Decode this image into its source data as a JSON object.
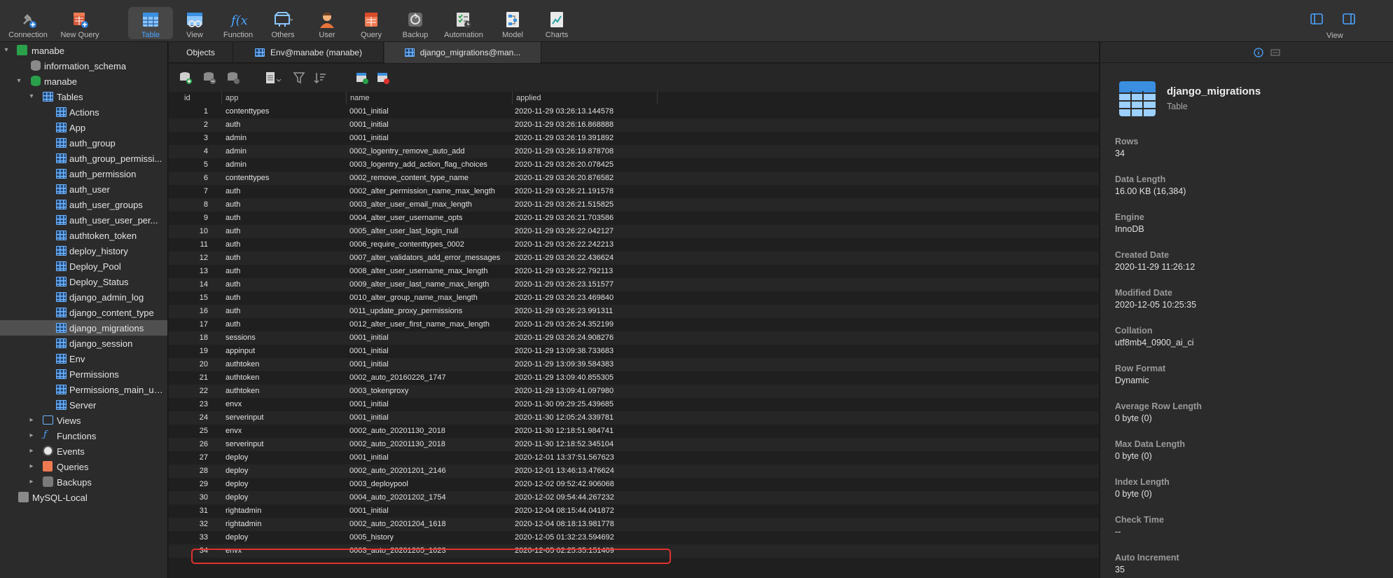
{
  "toolbar": {
    "connection": "Connection",
    "new_query": "New Query",
    "table": "Table",
    "view": "View",
    "function": "Function",
    "others": "Others",
    "user": "User",
    "query": "Query",
    "backup": "Backup",
    "automation": "Automation",
    "model": "Model",
    "charts": "Charts",
    "view_right": "View"
  },
  "sidebar": {
    "connection": "manabe",
    "db_information_schema": "information_schema",
    "db_manabe": "manabe",
    "tables_label": "Tables",
    "tables": [
      "Actions",
      "App",
      "auth_group",
      "auth_group_permissi...",
      "auth_permission",
      "auth_user",
      "auth_user_groups",
      "auth_user_user_per...",
      "authtoken_token",
      "deploy_history",
      "Deploy_Pool",
      "Deploy_Status",
      "django_admin_log",
      "django_content_type",
      "django_migrations",
      "django_session",
      "Env",
      "Permissions",
      "Permissions_main_us...",
      "Server"
    ],
    "views": "Views",
    "functions": "Functions",
    "events": "Events",
    "queries": "Queries",
    "backups": "Backups",
    "other_connection": "MySQL-Local"
  },
  "tabs": {
    "objects": "Objects",
    "env": "Env@manabe (manabe)",
    "migrations": "django_migrations@man..."
  },
  "grid": {
    "columns": {
      "id": "id",
      "app": "app",
      "name": "name",
      "applied": "applied"
    },
    "rows": [
      [
        "1",
        "contenttypes",
        "0001_initial",
        "2020-11-29 03:26:13.144578"
      ],
      [
        "2",
        "auth",
        "0001_initial",
        "2020-11-29 03:26:16.868888"
      ],
      [
        "3",
        "admin",
        "0001_initial",
        "2020-11-29 03:26:19.391892"
      ],
      [
        "4",
        "admin",
        "0002_logentry_remove_auto_add",
        "2020-11-29 03:26:19.878708"
      ],
      [
        "5",
        "admin",
        "0003_logentry_add_action_flag_choices",
        "2020-11-29 03:26:20.078425"
      ],
      [
        "6",
        "contenttypes",
        "0002_remove_content_type_name",
        "2020-11-29 03:26:20.876582"
      ],
      [
        "7",
        "auth",
        "0002_alter_permission_name_max_length",
        "2020-11-29 03:26:21.191578"
      ],
      [
        "8",
        "auth",
        "0003_alter_user_email_max_length",
        "2020-11-29 03:26:21.515825"
      ],
      [
        "9",
        "auth",
        "0004_alter_user_username_opts",
        "2020-11-29 03:26:21.703586"
      ],
      [
        "10",
        "auth",
        "0005_alter_user_last_login_null",
        "2020-11-29 03:26:22.042127"
      ],
      [
        "11",
        "auth",
        "0006_require_contenttypes_0002",
        "2020-11-29 03:26:22.242213"
      ],
      [
        "12",
        "auth",
        "0007_alter_validators_add_error_messages",
        "2020-11-29 03:26:22.436624"
      ],
      [
        "13",
        "auth",
        "0008_alter_user_username_max_length",
        "2020-11-29 03:26:22.792113"
      ],
      [
        "14",
        "auth",
        "0009_alter_user_last_name_max_length",
        "2020-11-29 03:26:23.151577"
      ],
      [
        "15",
        "auth",
        "0010_alter_group_name_max_length",
        "2020-11-29 03:26:23.469840"
      ],
      [
        "16",
        "auth",
        "0011_update_proxy_permissions",
        "2020-11-29 03:26:23.991311"
      ],
      [
        "17",
        "auth",
        "0012_alter_user_first_name_max_length",
        "2020-11-29 03:26:24.352199"
      ],
      [
        "18",
        "sessions",
        "0001_initial",
        "2020-11-29 03:26:24.908276"
      ],
      [
        "19",
        "appinput",
        "0001_initial",
        "2020-11-29 13:09:38.733683"
      ],
      [
        "20",
        "authtoken",
        "0001_initial",
        "2020-11-29 13:09:39.584383"
      ],
      [
        "21",
        "authtoken",
        "0002_auto_20160226_1747",
        "2020-11-29 13:09:40.855305"
      ],
      [
        "22",
        "authtoken",
        "0003_tokenproxy",
        "2020-11-29 13:09:41.097980"
      ],
      [
        "23",
        "envx",
        "0001_initial",
        "2020-11-30 09:29:25.439685"
      ],
      [
        "24",
        "serverinput",
        "0001_initial",
        "2020-11-30 12:05:24.339781"
      ],
      [
        "25",
        "envx",
        "0002_auto_20201130_2018",
        "2020-11-30 12:18:51.984741"
      ],
      [
        "26",
        "serverinput",
        "0002_auto_20201130_2018",
        "2020-11-30 12:18:52.345104"
      ],
      [
        "27",
        "deploy",
        "0001_initial",
        "2020-12-01 13:37:51.567623"
      ],
      [
        "28",
        "deploy",
        "0002_auto_20201201_2146",
        "2020-12-01 13:46:13.476624"
      ],
      [
        "29",
        "deploy",
        "0003_deploypool",
        "2020-12-02 09:52:42.906068"
      ],
      [
        "30",
        "deploy",
        "0004_auto_20201202_1754",
        "2020-12-02 09:54:44.267232"
      ],
      [
        "31",
        "rightadmin",
        "0001_initial",
        "2020-12-04 08:15:44.041872"
      ],
      [
        "32",
        "rightadmin",
        "0002_auto_20201204_1618",
        "2020-12-04 08:18:13.981778"
      ],
      [
        "33",
        "deploy",
        "0005_history",
        "2020-12-05 01:32:23.594692"
      ],
      [
        "34",
        "envx",
        "0003_auto_20201205_1023",
        "2020-12-05 02:25:35.151409"
      ]
    ]
  },
  "info": {
    "title": "django_migrations",
    "subtitle": "Table",
    "props": [
      {
        "label": "Rows",
        "value": "34"
      },
      {
        "label": "Data Length",
        "value": "16.00 KB (16,384)"
      },
      {
        "label": "Engine",
        "value": "InnoDB"
      },
      {
        "label": "Created Date",
        "value": "2020-11-29 11:26:12"
      },
      {
        "label": "Modified Date",
        "value": "2020-12-05 10:25:35"
      },
      {
        "label": "Collation",
        "value": "utf8mb4_0900_ai_ci"
      },
      {
        "label": "Row Format",
        "value": "Dynamic"
      },
      {
        "label": "Average Row Length",
        "value": "0 byte (0)"
      },
      {
        "label": "Max Data Length",
        "value": "0 byte (0)"
      },
      {
        "label": "Index Length",
        "value": "0 byte (0)"
      },
      {
        "label": "Check Time",
        "value": "--"
      },
      {
        "label": "Auto Increment",
        "value": "35"
      }
    ]
  },
  "colors": {
    "accent": "#4aa3ff",
    "highlight": "#e0322e",
    "selected_row": "#505050"
  }
}
